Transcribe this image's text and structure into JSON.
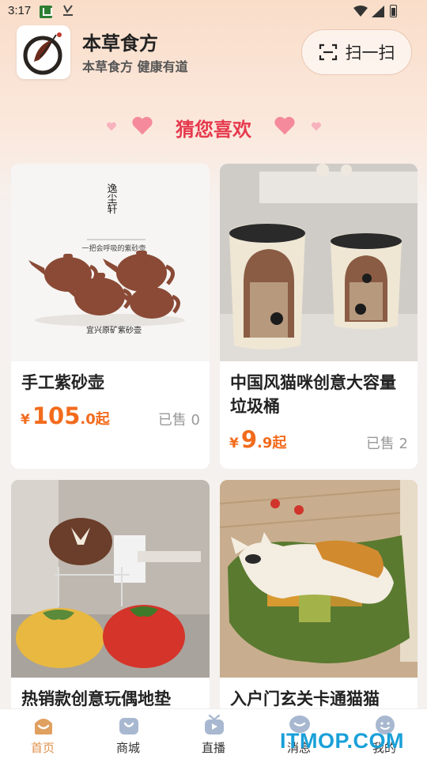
{
  "status_bar": {
    "time": "3:17"
  },
  "header": {
    "app_name": "本草食方",
    "slogan": "本草食方 健康有道",
    "scan_label": "扫一扫"
  },
  "section": {
    "title": "猜您喜欢"
  },
  "products": [
    {
      "title": "手工紫砂壶",
      "currency": "¥",
      "price_int": "105",
      "price_dec": ".0",
      "price_suffix": "起",
      "sold": "已售 0",
      "image_text": {
        "brand": "逸尘轩",
        "line1": "一把会呼吸的紫砂壶",
        "line2": "宜兴原矿紫砂壶"
      }
    },
    {
      "title": "中国风猫咪创意大容量垃圾桶",
      "currency": "¥",
      "price_int": "9",
      "price_dec": ".9",
      "price_suffix": "起",
      "sold": "已售 2"
    },
    {
      "title": "热销款创意玩偶地垫"
    },
    {
      "title": "入户门玄关卡通猫猫"
    }
  ],
  "bottom_nav": [
    {
      "label": "首页",
      "icon": "home-icon",
      "active": true
    },
    {
      "label": "商城",
      "icon": "shop-bag-icon",
      "active": false
    },
    {
      "label": "直播",
      "icon": "live-tv-icon",
      "active": false
    },
    {
      "label": "消息",
      "icon": "message-icon",
      "active": false
    },
    {
      "label": "我的",
      "icon": "profile-icon",
      "active": false
    }
  ],
  "watermark": "ITMOP.COM",
  "colors": {
    "accent": "#e63a4e",
    "price": "#f26b1d",
    "nav_active": "#e0904b",
    "nav_icon": "#a8b8d0",
    "watermark": "#19a0d8"
  }
}
